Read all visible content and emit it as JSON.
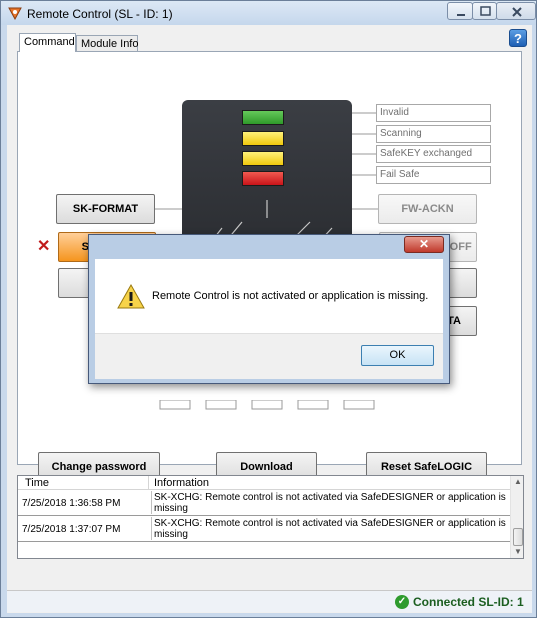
{
  "window": {
    "title": "Remote Control (SL - ID: 1)"
  },
  "tabs": [
    {
      "label": "Command",
      "active": true
    },
    {
      "label": "Module Info",
      "active": false
    }
  ],
  "help_icon": "?",
  "status_fields": {
    "invalid": "Invalid",
    "scanning": "Scanning",
    "safekey": "SafeKEY exchanged",
    "failsafe": "Fail Safe"
  },
  "buttons": {
    "sk_format": "SK-FORMAT",
    "sk_xchg": "SK-XCHG",
    "fw_ackn": "FW-ACKN",
    "setup_mode": "Setup Mode OFF",
    "partial_right": "TA",
    "change_password": "Change password",
    "download": "Download",
    "reset": "Reset SafeLOGIC"
  },
  "xchg_error_mark": "✕",
  "dialog": {
    "close": "✕",
    "message": "Remote Control is not activated or application is missing.",
    "ok": "OK"
  },
  "log": {
    "columns": [
      "Time",
      "Information"
    ],
    "rows": [
      {
        "time": "7/25/2018 1:36:58 PM",
        "info": "SK-XCHG: Remote control is not activated via SafeDESIGNER or application is missing"
      },
      {
        "time": "7/25/2018 1:37:07 PM",
        "info": "SK-XCHG: Remote control is not activated via SafeDESIGNER or application is missing"
      }
    ]
  },
  "statusbar": {
    "text": "Connected SL-ID: 1"
  },
  "colors": {
    "accent_orange": "#f5951e",
    "led_green": "#2f9a2a",
    "led_yellow": "#f0c80d",
    "led_red": "#c9141a",
    "connected_green": "#1b5e20"
  }
}
